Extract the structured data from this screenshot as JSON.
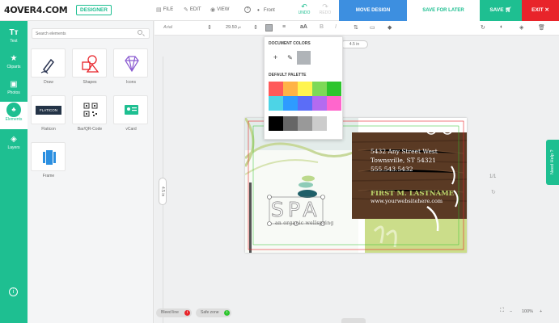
{
  "brand": {
    "logo": "4OVER4.COM",
    "badge": "DESIGNER"
  },
  "menu": {
    "file": "FILE",
    "edit": "EDIT",
    "view": "VIEW",
    "help": "?",
    "front": "Front"
  },
  "history": {
    "undo": "UNDO",
    "redo": "REDO"
  },
  "actions": {
    "move": "MOVE DESIGN",
    "later": "SAVE FOR LATER",
    "save": "SAVE",
    "exit": "EXIT"
  },
  "rail": {
    "text": "Text",
    "cliparts": "Cliparts",
    "photos": "Photos",
    "elements": "Elements",
    "layers": "Layers"
  },
  "panel": {
    "search_placeholder": "Search elements",
    "tiles": [
      {
        "label": "Draw",
        "icon": "pen-icon"
      },
      {
        "label": "Shapes",
        "icon": "shapes-icon"
      },
      {
        "label": "Icons",
        "icon": "diamond-icon"
      },
      {
        "label": "Flaticon",
        "icon": "flaticon-logo"
      },
      {
        "label": "Bar/QR-Code",
        "icon": "qr-icon"
      },
      {
        "label": "vCard",
        "icon": "vcard-icon"
      },
      {
        "label": "Frame",
        "icon": "frame-icon"
      }
    ],
    "flaticon_text": "FLATICON"
  },
  "toolbar": {
    "font": "Arial",
    "size": "29.50",
    "size_unit": "pt"
  },
  "dims": {
    "width": "4.5 in",
    "height": "4.5 in"
  },
  "dropdown": {
    "doc_colors": "DOCUMENT COLORS",
    "default_palette": "DEFAULT PALETTE",
    "doc_swatch": "#b0b4b8",
    "palette": [
      "#ff5a5a",
      "#ffb347",
      "#fff44f",
      "#7ed957",
      "#2ec52e",
      "#4dd4e6",
      "#2e9bff",
      "#5b6df7",
      "#b46bf0",
      "#ff66cc"
    ],
    "grays": [
      "#000000",
      "#666666",
      "#999999",
      "#cccccc"
    ]
  },
  "card": {
    "address1": "5432 Any Street West",
    "address2": "Townsville, ST 54321",
    "phone": "555.543.5432",
    "name": "FIRST M. LASTNAME",
    "website": "www.yourwebsitehere.com",
    "logo_text": "SPA",
    "tagline": "an organic wellspring"
  },
  "footer": {
    "bleed": "Bleed line",
    "safe": "Safe zone",
    "page": "1/1",
    "zoom": "100%"
  },
  "need_help": "Need Help ?"
}
